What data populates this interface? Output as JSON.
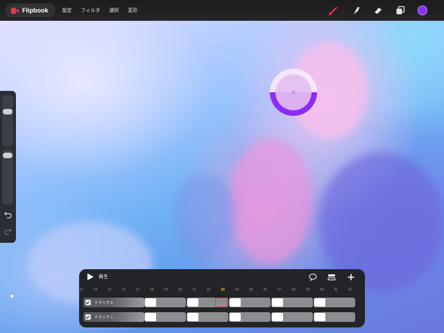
{
  "app": {
    "name": "Flipbook",
    "icon": "flipbook-logo-icon"
  },
  "menu": [
    "設定",
    "フィルタ",
    "選択",
    "変形"
  ],
  "tools": [
    {
      "name": "brush-icon",
      "color": "#e8334a"
    },
    {
      "name": "smudge-icon",
      "color": "#e6e6ea"
    },
    {
      "name": "eraser-icon",
      "color": "#e6e6ea"
    },
    {
      "name": "layers-icon",
      "color": "#e6e6ea"
    }
  ],
  "current_color": "#8b2cf5",
  "sidebar": {
    "brush_size_level": 0.2,
    "opacity_level": 0.0,
    "undo_icon": "undo-icon",
    "redo_icon": "redo-icon"
  },
  "color_ring": {
    "fill_fraction": 0.5
  },
  "timeline": {
    "play_label": "再生",
    "icons": [
      "comment-icon",
      "settings-stack-icon",
      "add-icon"
    ],
    "frames": [
      "23",
      "24",
      "25",
      "26",
      "27",
      "28",
      "29",
      "30",
      "31",
      "32",
      "33",
      "34",
      "35",
      "36",
      "37",
      "38",
      "39",
      "40",
      "41",
      "42"
    ],
    "current_frame": "33",
    "tracks": [
      {
        "name": "トラック 2",
        "checked": true
      },
      {
        "name": "トラック 1",
        "checked": true
      }
    ]
  }
}
